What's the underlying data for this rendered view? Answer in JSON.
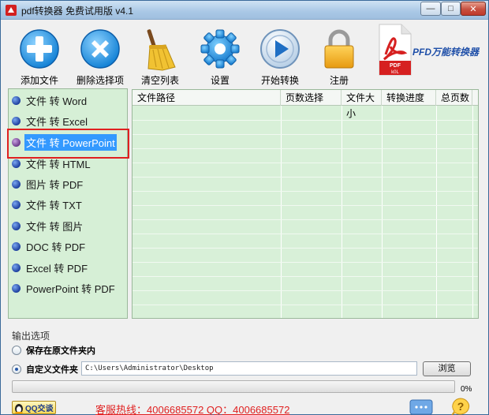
{
  "window": {
    "title": "pdf转换器 免费试用版 v4.1",
    "min_glyph": "—",
    "max_glyph": "□",
    "close_glyph": "✕"
  },
  "toolbar": {
    "add_files": "添加文件",
    "remove_selected": "删除选择项",
    "clear_list": "清空列表",
    "settings": "设置",
    "start_convert": "开始转换",
    "register": "注册"
  },
  "brand": {
    "logo_line1": "PDF",
    "logo_line2": "k0L",
    "name": "PFD万能转换器"
  },
  "conversions": [
    {
      "label": "文件 转 Word",
      "selected": false
    },
    {
      "label": "文件 转 Excel",
      "selected": false
    },
    {
      "label": "文件 转 PowerPoint",
      "selected": true
    },
    {
      "label": "文件 转 HTML",
      "selected": false
    },
    {
      "label": "图片 转 PDF",
      "selected": false
    },
    {
      "label": "文件 转 TXT",
      "selected": false
    },
    {
      "label": "文件 转 图片",
      "selected": false
    },
    {
      "label": "DOC 转 PDF",
      "selected": false
    },
    {
      "label": "Excel 转 PDF",
      "selected": false
    },
    {
      "label": "PowerPoint 转 PDF",
      "selected": false
    }
  ],
  "table": {
    "columns": [
      "文件路径",
      "页数选择",
      "文件大小",
      "转换进度",
      "总页数"
    ],
    "rows": []
  },
  "output": {
    "title": "输出选项",
    "keep_original_folder": "保存在原文件夹内",
    "custom_folder": "自定义文件夹",
    "custom_path": "C:\\Users\\Administrator\\Desktop",
    "browse": "浏览",
    "selected_option": "custom_folder"
  },
  "progress": {
    "value": 0,
    "text": "0%"
  },
  "footer": {
    "qq_label": "QQ交谈",
    "hotline": "客服热线：4006685572 QQ：4006685572"
  },
  "colors": {
    "panel_green": "#d6efd6",
    "selection_blue": "#3399ff",
    "highlight_red": "#e02020",
    "brand_blue": "#1f4fa8"
  },
  "icons": {
    "add": "plus-icon",
    "remove": "x-icon",
    "clear": "broom-icon",
    "settings": "gear-icon",
    "start": "play-icon",
    "register": "lock-icon"
  }
}
